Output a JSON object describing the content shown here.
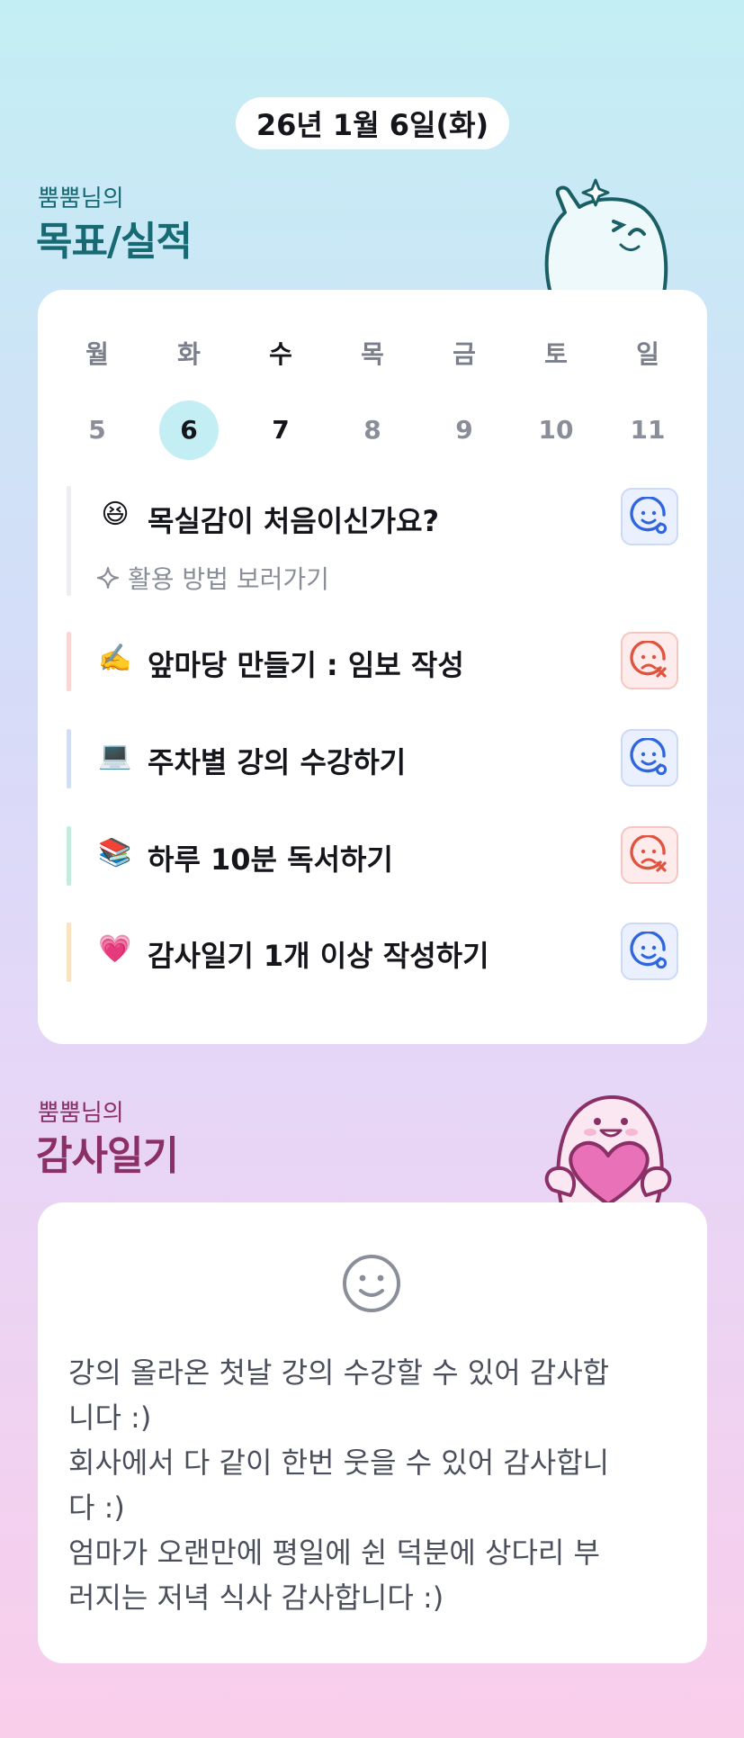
{
  "date": "26년 1월 6일(화)",
  "goals_section": {
    "owner": "뿜뿜님의",
    "title": "목표/실적"
  },
  "week": {
    "days": [
      {
        "label": "월",
        "num": "5"
      },
      {
        "label": "화",
        "num": "6"
      },
      {
        "label": "수",
        "num": "7"
      },
      {
        "label": "목",
        "num": "8"
      },
      {
        "label": "금",
        "num": "9"
      },
      {
        "label": "토",
        "num": "10"
      },
      {
        "label": "일",
        "num": "11"
      }
    ],
    "selected": "6",
    "today": "7"
  },
  "intro": {
    "emoji": "😆",
    "title": "목실감이 처음이신가요?",
    "link": "활용 방법 보러가기",
    "status": "smile-check"
  },
  "goals": [
    {
      "emoji": "✍️",
      "text": "앞마당 만들기 : 임보 작성",
      "status": "fail",
      "bar": "#fbd6d2"
    },
    {
      "emoji": "💻",
      "text": "주차별 강의 수강하기",
      "status": "done",
      "bar": "#d2ddf6"
    },
    {
      "emoji": "📚",
      "text": "하루 10분 독서하기",
      "status": "fail",
      "bar": "#c4ecdd"
    },
    {
      "emoji": "💗",
      "text": "감사일기 1개 이상 작성하기",
      "status": "done",
      "bar": "#fbe3c2"
    }
  ],
  "colors": {
    "brand_teal": "#176a73",
    "brand_plum": "#8b2f67",
    "ok_blue": "#2f66e0",
    "fail_red": "#e0533e",
    "selected_day_bg": "#c3eef4"
  },
  "gratitude_section": {
    "owner": "뿜뿜님의",
    "title": "감사일기"
  },
  "diary": {
    "lines": [
      "강의 올라온 첫날 강의 수강할 수 있어 감사합",
      "니다 :)",
      "회사에서 다 같이 한번 웃을 수 있어 감사합니",
      "다 :)",
      "엄마가 오랜만에 평일에 쉰 덕분에 상다리 부",
      "러지는 저녁 식사 감사합니다 :)"
    ]
  }
}
